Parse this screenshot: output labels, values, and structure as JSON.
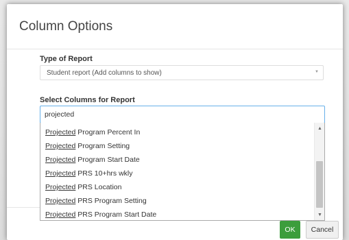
{
  "dialog": {
    "title": "Column Options",
    "type_label": "Type of Report",
    "type_value": "Student report (Add columns to show)",
    "columns_label": "Select Columns for Report",
    "search_value": "projected",
    "options": [
      {
        "highlight": "Projected",
        "rest": " Program Percent In"
      },
      {
        "highlight": "Projected",
        "rest": " Program Setting"
      },
      {
        "highlight": "Projected",
        "rest": " Program Start Date"
      },
      {
        "highlight": "Projected",
        "rest": " PRS 10+hrs wkly"
      },
      {
        "highlight": "Projected",
        "rest": " PRS Location"
      },
      {
        "highlight": "Projected",
        "rest": " PRS Program Setting"
      },
      {
        "highlight": "Projected",
        "rest": " PRS Program Start Date"
      }
    ],
    "ok_label": "OK",
    "cancel_label": "Cancel"
  },
  "icons": {
    "select_arrow": "chevron-down-icon",
    "scroll_up": "scroll-up-icon",
    "scroll_down": "scroll-down-icon"
  },
  "colors": {
    "ok_button": "#3c9d3c",
    "focus_border": "#66afe9"
  }
}
